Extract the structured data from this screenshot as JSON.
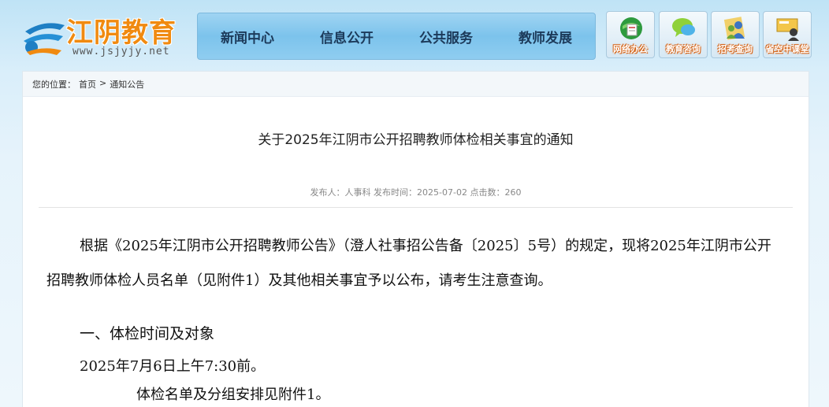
{
  "header": {
    "logo_title": "江阴教育",
    "logo_url": "www.jsjyjy.net",
    "nav": [
      "新闻中心",
      "信息公开",
      "公共服务",
      "教师发展"
    ],
    "quick_links": [
      {
        "label": "网络办公",
        "icon": "globe-icon"
      },
      {
        "label": "教育咨询",
        "icon": "chat-bubble-icon"
      },
      {
        "label": "招考查询",
        "icon": "people-icon"
      },
      {
        "label": "省空中课堂",
        "icon": "classroom-icon"
      }
    ]
  },
  "breadcrumb": {
    "prefix": "您的位置：",
    "home": "首页",
    "separator": ">",
    "current": "通知公告"
  },
  "article": {
    "title": "关于2025年江阴市公开招聘教师体检相关事宜的通知",
    "meta": "发布人：人事科  发布时间：2025-07-02 点击数：260",
    "paragraph": "根据《2025年江阴市公开招聘教师公告》（澄人社事招公告备〔2025〕5号）的规定，现将2025年江阴市公开招聘教师体检人员名单（见附件1）及其他相关事宜予以公布，请考生注意查询。",
    "section_heading": "一、体检时间及对象",
    "time_line": "2025年7月6日上午7:30前。",
    "schedule_line": "体检名单及分组安排见附件1。"
  },
  "colors": {
    "logo": "#f08a10",
    "nav_bg": "#7cc3ec",
    "nav_text": "#1c3a5a"
  }
}
